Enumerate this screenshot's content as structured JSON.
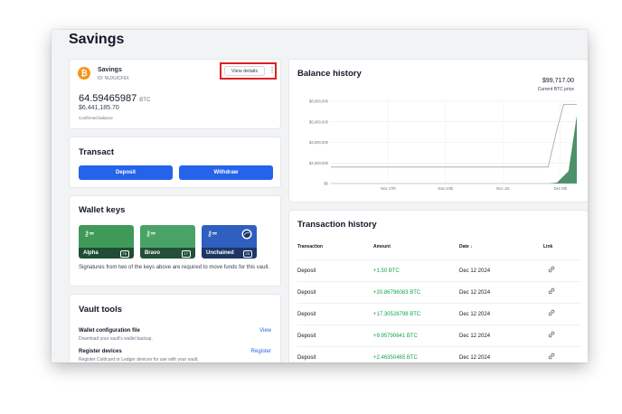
{
  "page": {
    "title": "Savings"
  },
  "savings": {
    "name": "Savings",
    "id": "ID: NUXUCF6X",
    "view_details": "View details",
    "btc_amount": "64.59465987",
    "btc_unit": "BTC",
    "usd_amount": "$6,441,185.70",
    "confirmed_label": "Confirmed balance"
  },
  "transact": {
    "title": "Transact",
    "deposit": "Deposit",
    "withdraw": "Withdraw"
  },
  "wallet_keys": {
    "title": "Wallet keys",
    "keys": [
      {
        "name": "Alpha",
        "code": "76",
        "color": "#3f9a5a",
        "color_dark": "#1f4d35"
      },
      {
        "name": "Bravo",
        "code": "17",
        "color": "#4aa366",
        "color_dark": "#24503a"
      },
      {
        "name": "Unchained",
        "code": "23",
        "color": "#2f5fbf",
        "color_dark": "#1c3766"
      }
    ],
    "signatures_note": "Signatures from two of the keys above are required to move funds for this vault."
  },
  "vault_tools": {
    "title": "Vault tools",
    "items": [
      {
        "title": "Wallet configuration file",
        "desc": "Download your vault's wallet backup.",
        "action": "View"
      },
      {
        "title": "Register devices",
        "desc": "Register Coldcard or Ledger devices for use with your vault.",
        "action": "Register"
      }
    ]
  },
  "balance_history": {
    "title": "Balance history",
    "price": "$99,717.00",
    "price_caption": "Current BTC price"
  },
  "chart_data": {
    "type": "area",
    "x_ticks": [
      "Nov 17th",
      "Nov 24th",
      "Dec 1st",
      "Dec 8th"
    ],
    "y_ticks": [
      "$8,000,000",
      "$6,000,000",
      "$4,000,000",
      "$2,000,000",
      "$0"
    ],
    "ylim": [
      0,
      8000000
    ],
    "x_range": [
      0,
      30
    ],
    "grid": true,
    "fill_color": "#2e7d4f",
    "series": [
      {
        "x": [
          0,
          26.5,
          27.5,
          28.4,
          30
        ],
        "values": [
          1600000,
          1600000,
          5000000,
          7700000,
          7700000
        ]
      },
      {
        "x": [
          0,
          26.5,
          27.6,
          29,
          30
        ],
        "values": [
          0,
          0,
          100000,
          1200000,
          6600000
        ]
      }
    ]
  },
  "transaction_history": {
    "title": "Transaction history",
    "columns": {
      "type": "Transaction",
      "amount": "Amount",
      "date": "Date ↓",
      "link": "Link"
    },
    "rows": [
      {
        "type": "Deposit",
        "amount": "+1.50 BTC",
        "date": "Dec 12 2024"
      },
      {
        "type": "Deposit",
        "amount": "+20.86796083 BTC",
        "date": "Dec 12 2024"
      },
      {
        "type": "Deposit",
        "amount": "+17.30528798 BTC",
        "date": "Dec 12 2024"
      },
      {
        "type": "Deposit",
        "amount": "+9.95790641 BTC",
        "date": "Dec 12 2024"
      },
      {
        "type": "Deposit",
        "amount": "+2.46350465 BTC",
        "date": "Dec 12 2024"
      }
    ]
  }
}
